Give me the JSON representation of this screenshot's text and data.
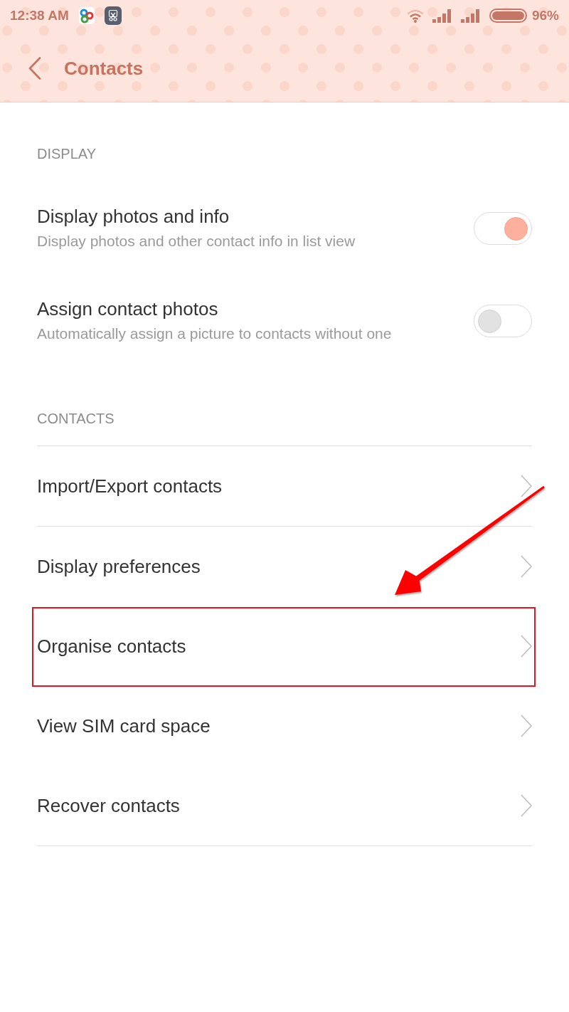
{
  "status_bar": {
    "time": "12:38 AM",
    "battery": "96%"
  },
  "header": {
    "title": "Contacts"
  },
  "sections": [
    {
      "title": "DISPLAY",
      "kind": "toggles",
      "items": [
        {
          "title": "Display photos and info",
          "subtitle": "Display photos and other contact info in list view",
          "on": true
        },
        {
          "title": "Assign contact photos",
          "subtitle": "Automatically assign a picture to contacts without one",
          "on": false
        }
      ]
    },
    {
      "title": "CONTACTS",
      "kind": "links",
      "groups": [
        {
          "items": [
            {
              "title": "Import/Export contacts",
              "highlighted": false
            }
          ]
        },
        {
          "items": [
            {
              "title": "Display preferences",
              "highlighted": false
            },
            {
              "title": "Organise contacts",
              "highlighted": true
            },
            {
              "title": "View SIM card space",
              "highlighted": false
            },
            {
              "title": "Recover contacts",
              "highlighted": false
            }
          ]
        }
      ]
    }
  ]
}
